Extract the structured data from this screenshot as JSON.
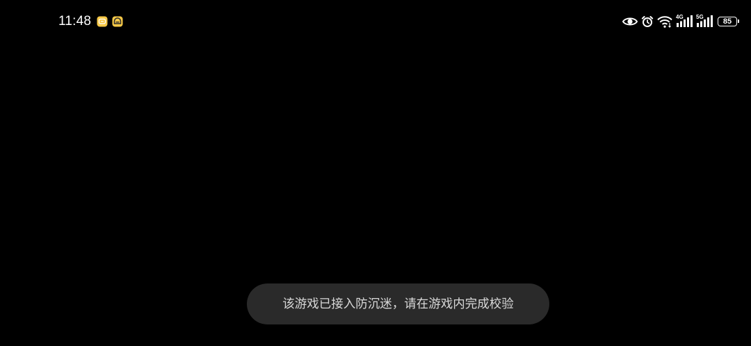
{
  "status_bar": {
    "time": "11:48",
    "notification_icons": [
      "message-icon",
      "game-app-icon"
    ],
    "system_icons": [
      "eye-comfort-icon",
      "alarm-icon",
      "wifi-icon",
      "cellular-4g-icon",
      "cellular-5g-icon",
      "battery-icon"
    ],
    "network_1": "4G",
    "network_2": "5G",
    "battery_level": "85",
    "notification_color": "#f7c948"
  },
  "toast": {
    "message": "该游戏已接入防沉迷，请在游戏内完成校验"
  },
  "colors": {
    "background": "#000000",
    "toast_background": "#2a2a2a",
    "toast_text": "#d8d8d8"
  }
}
